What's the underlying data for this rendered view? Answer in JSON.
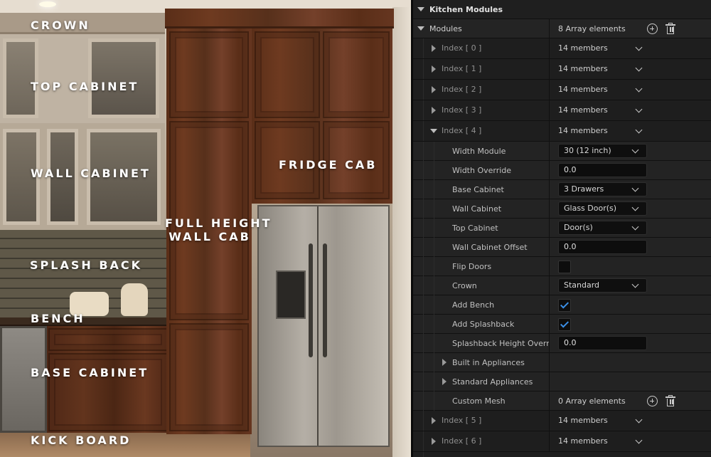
{
  "viewport": {
    "labels": {
      "crown": "CROWN",
      "top_cabinet": "TOP CABINET",
      "wall_cabinet": "WALL CABINET",
      "fridge_cab": "FRIDGE CAB",
      "full_height_line1": "FULL HEIGHT",
      "full_height_line2": "WALL CAB",
      "splash_back": "SPLASH BACK",
      "bench": "BENCH",
      "base_cabinet": "BASE CABINET",
      "kick_board": "KICK BOARD"
    }
  },
  "panel": {
    "section_title": "Kitchen Modules",
    "modules": {
      "label": "Modules",
      "value": "8 Array elements"
    },
    "index_rows_before": [
      {
        "label": "Index [ 0 ]",
        "value": "14 members"
      },
      {
        "label": "Index [ 1 ]",
        "value": "14 members"
      },
      {
        "label": "Index [ 2 ]",
        "value": "14 members"
      },
      {
        "label": "Index [ 3 ]",
        "value": "14 members"
      }
    ],
    "expanded_index": {
      "label": "Index [ 4 ]",
      "value": "14 members"
    },
    "properties": {
      "width_module": {
        "label": "Width Module",
        "value": "30 (12 inch)"
      },
      "width_override": {
        "label": "Width Override",
        "value": "0.0"
      },
      "base_cabinet": {
        "label": "Base Cabinet",
        "value": "3 Drawers"
      },
      "wall_cabinet": {
        "label": "Wall Cabinet",
        "value": "Glass Door(s)"
      },
      "top_cabinet": {
        "label": "Top Cabinet",
        "value": "Door(s)"
      },
      "wall_cabinet_offset": {
        "label": "Wall Cabinet Offset",
        "value": "0.0"
      },
      "flip_doors": {
        "label": "Flip Doors",
        "checked": false
      },
      "crown": {
        "label": "Crown",
        "value": "Standard"
      },
      "add_bench": {
        "label": "Add Bench",
        "checked": true
      },
      "add_splashback": {
        "label": "Add Splashback",
        "checked": true
      },
      "splashback_height": {
        "label": "Splashback Height Overri...",
        "value": "0.0"
      },
      "built_in_appliances": {
        "label": "Built in Appliances"
      },
      "standard_appliances": {
        "label": "Standard Appliances"
      },
      "custom_mesh": {
        "label": "Custom Mesh",
        "value": "0 Array elements"
      }
    },
    "index_rows_after": [
      {
        "label": "Index [ 5 ]",
        "value": "14 members"
      },
      {
        "label": "Index [ 6 ]",
        "value": "14 members"
      }
    ]
  }
}
